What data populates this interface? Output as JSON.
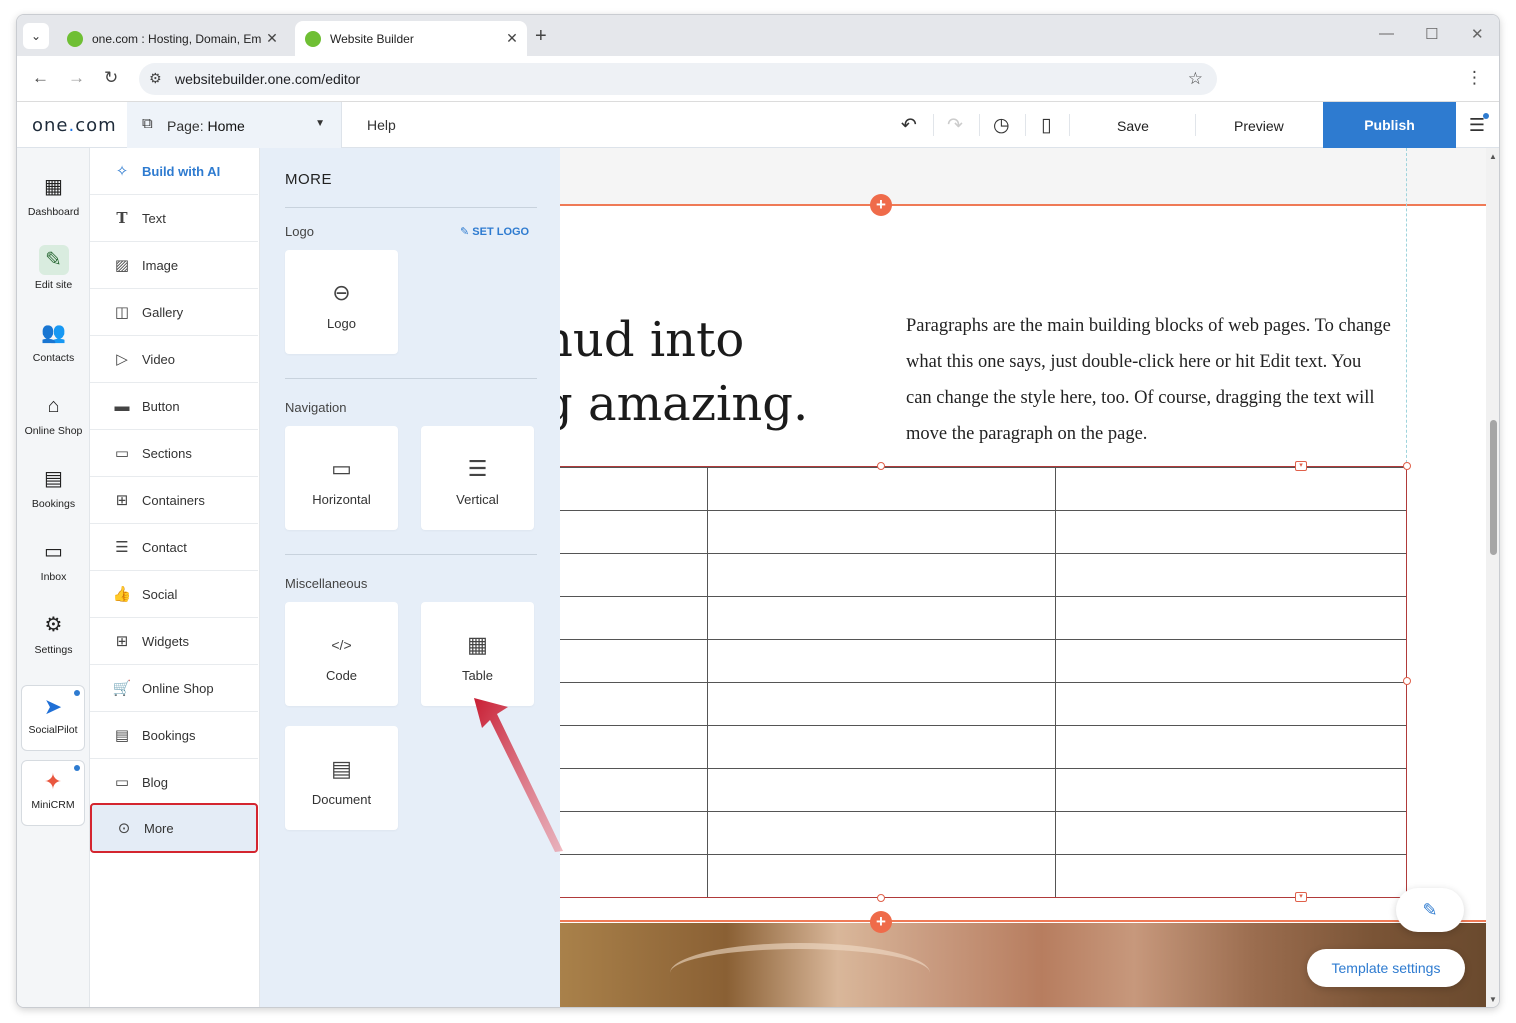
{
  "browser": {
    "tabs": [
      {
        "title": "one.com : Hosting, Domain, Em",
        "active": false
      },
      {
        "title": "Website Builder",
        "active": true
      }
    ],
    "url": "websitebuilder.one.com/editor"
  },
  "topbar": {
    "logo_text": "one",
    "logo_dot": ".",
    "logo_suffix": "com",
    "page_prefix": "Page:",
    "page_name": "Home",
    "help": "Help",
    "save": "Save",
    "preview": "Preview",
    "publish": "Publish"
  },
  "rail": {
    "items": [
      {
        "label": "Dashboard",
        "icon": "dashboard-icon"
      },
      {
        "label": "Edit site",
        "icon": "edit-site-icon",
        "active": true
      },
      {
        "label": "Contacts",
        "icon": "contacts-icon"
      },
      {
        "label": "Online Shop",
        "icon": "shop-icon"
      },
      {
        "label": "Bookings",
        "icon": "bookings-icon"
      },
      {
        "label": "Inbox",
        "icon": "inbox-icon"
      },
      {
        "label": "Settings",
        "icon": "gear-icon"
      }
    ],
    "apps": [
      {
        "label": "SocialPilot",
        "icon": "socialpilot-icon"
      },
      {
        "label": "MiniCRM",
        "icon": "minicrm-icon"
      }
    ]
  },
  "elements": {
    "items": [
      {
        "label": "Build with AI",
        "icon": "sparkle-icon"
      },
      {
        "label": "Text",
        "icon": "text-icon"
      },
      {
        "label": "Image",
        "icon": "image-icon"
      },
      {
        "label": "Gallery",
        "icon": "gallery-icon"
      },
      {
        "label": "Video",
        "icon": "video-icon"
      },
      {
        "label": "Button",
        "icon": "button-icon"
      },
      {
        "label": "Sections",
        "icon": "sections-icon"
      },
      {
        "label": "Containers",
        "icon": "containers-icon"
      },
      {
        "label": "Contact",
        "icon": "contact-form-icon"
      },
      {
        "label": "Social",
        "icon": "thumbs-up-icon"
      },
      {
        "label": "Widgets",
        "icon": "widgets-icon"
      },
      {
        "label": "Online Shop",
        "icon": "cart-icon"
      },
      {
        "label": "Bookings",
        "icon": "calendar-icon"
      },
      {
        "label": "Blog",
        "icon": "blog-icon"
      },
      {
        "label": "More",
        "icon": "more-icon",
        "selected": true
      }
    ]
  },
  "more_panel": {
    "title": "MORE",
    "logo_section": "Logo",
    "set_logo": "SET LOGO",
    "logo_card": "Logo",
    "navigation_section": "Navigation",
    "nav_horizontal": "Horizontal",
    "nav_vertical": "Vertical",
    "misc_section": "Miscellaneous",
    "code": "Code",
    "table": "Table",
    "document": "Document"
  },
  "canvas": {
    "heading_line1": "nud into",
    "heading_line2": "g amazing.",
    "paragraph": "Paragraphs are the main building blocks of web pages. To change what this one says, just double-click here or hit Edit text. You can change the style here, too. Of course, dragging the text will move the paragraph on the page.",
    "table_rows": 10,
    "table_cols": 3
  },
  "floating": {
    "template_settings": "Template settings"
  },
  "colors": {
    "accent": "#2e7bd0",
    "section_line": "#ef7a56",
    "highlight_box": "#d4252f",
    "arrow": "#c81e33"
  }
}
